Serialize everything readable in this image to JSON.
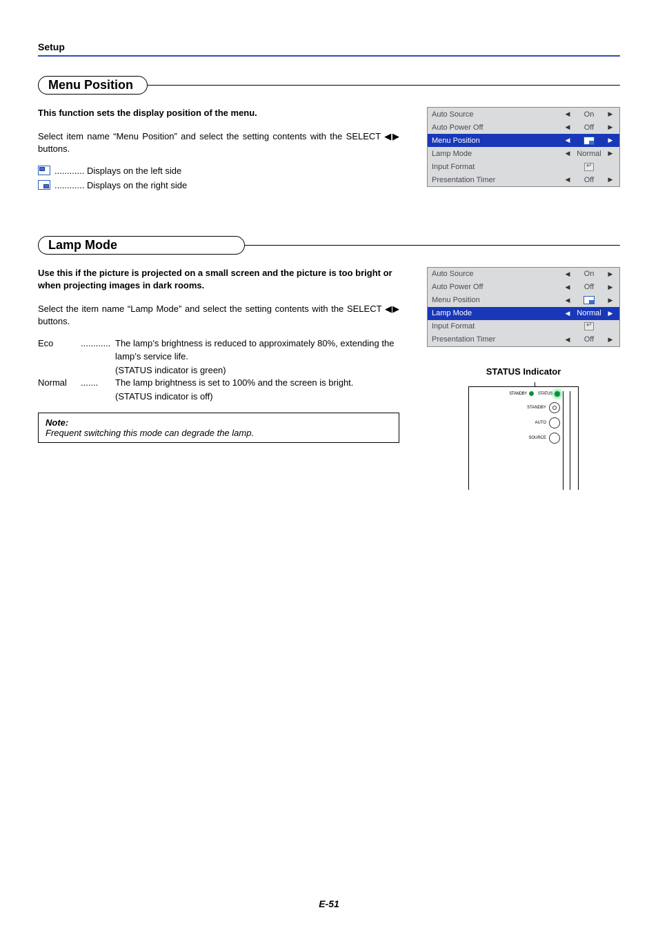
{
  "header": "Setup",
  "page_number": "E-51",
  "section1": {
    "title": "Menu Position",
    "intro": "This function sets the display position of the menu.",
    "body": "Select item name “Menu Position” and select the setting contents with the SELECT ◀▶ buttons.",
    "opt1": "............ Displays on the left side",
    "opt2": "............ Displays on the right side"
  },
  "osd1": {
    "r0": {
      "label": "Auto Source",
      "value": "On"
    },
    "r1": {
      "label": "Auto Power Off",
      "value": "Off"
    },
    "r2": {
      "label": "Menu Position",
      "value": ""
    },
    "r3": {
      "label": "Lamp Mode",
      "value": "Normal"
    },
    "r4": {
      "label": "Input Format",
      "value": ""
    },
    "r5": {
      "label": "Presentation Timer",
      "value": "Off"
    }
  },
  "section2": {
    "title": "Lamp Mode",
    "intro": "Use this if the picture is projected on a small screen and the picture is too bright or when projecting images in dark rooms.",
    "body": "Select the item name “Lamp Mode” and select the setting contents with the SELECT ◀▶ buttons.",
    "eco_term": "Eco",
    "eco_dots": "............",
    "eco_desc": "The lamp’s brightness is reduced to approximately 80%, extending the lamp’s service life.",
    "eco_sub": "(STATUS indicator is green)",
    "normal_term": "Normal",
    "normal_dots": ".......",
    "normal_desc": "The lamp brightness is set to 100% and the screen is bright.",
    "normal_sub": "(STATUS indicator is off)",
    "note_title": "Note:",
    "note_body": "Frequent switching this mode can degrade the lamp."
  },
  "osd2": {
    "r0": {
      "label": "Auto Source",
      "value": "On"
    },
    "r1": {
      "label": "Auto Power Off",
      "value": "Off"
    },
    "r2": {
      "label": "Menu Position",
      "value": ""
    },
    "r3": {
      "label": "Lamp Mode",
      "value": "Normal"
    },
    "r4": {
      "label": "Input Format",
      "value": ""
    },
    "r5": {
      "label": "Presentation Timer",
      "value": "Off"
    }
  },
  "status": {
    "label": "STATUS Indicator",
    "standby": "STANDBY",
    "status_lbl": "STATUS",
    "standby2": "STANDBY",
    "auto": "AUTO",
    "source": "SOURCE"
  }
}
